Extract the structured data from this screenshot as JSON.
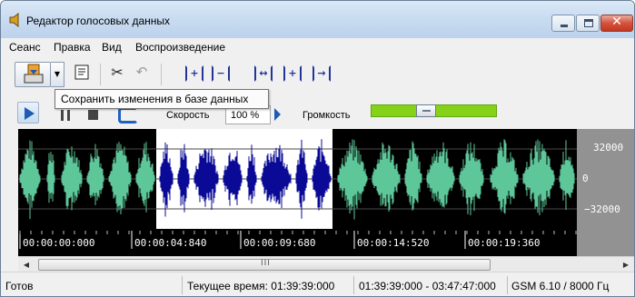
{
  "window": {
    "title": "Редактор голосовых данных",
    "controls": {
      "minimize": "minimize",
      "maximize": "maximize",
      "close": "✕"
    }
  },
  "menu": {
    "items": [
      {
        "label": "Сеанс"
      },
      {
        "label": "Правка"
      },
      {
        "label": "Вид"
      },
      {
        "label": "Воспроизведение"
      }
    ]
  },
  "toolbar": {
    "tooltip": "Сохранить изменения в базе данных",
    "icons": [
      "save-icon",
      "dropdown-arrow-icon",
      "properties-icon",
      "cut-icon",
      "undo-icon",
      "select-all-icon",
      "select-range-icon",
      "zoom-fit-icon",
      "zoom-in-selection-icon",
      "go-to-end-icon"
    ]
  },
  "playback": {
    "speed_label": "Скорость",
    "speed_value": "100 %",
    "volume_label": "Громкость",
    "volume_level": 0.43,
    "accent_color": "#86d21a"
  },
  "waveform": {
    "colors": {
      "unselected": "#5ec79a",
      "selected": "#0a0a96",
      "selection_bg": "#ffffff",
      "background": "#000000"
    },
    "selection_range": [
      "00:00:04:840",
      "00:00:12:100"
    ],
    "amplitude_labels": [
      "32000",
      "0",
      "−32000"
    ],
    "time_ticks": [
      "00:00:00:000",
      "00:00:04:840",
      "00:00:09:680",
      "00:00:14:520",
      "00:00:19:360"
    ]
  },
  "scrollbar": {
    "grip": "III"
  },
  "status": {
    "state": "Готов",
    "current_time": "Текущее время: 01:39:39:000",
    "range": "01:39:39:000 - 03:47:47:000",
    "format": "GSM 6.10 / 8000 Гц"
  }
}
